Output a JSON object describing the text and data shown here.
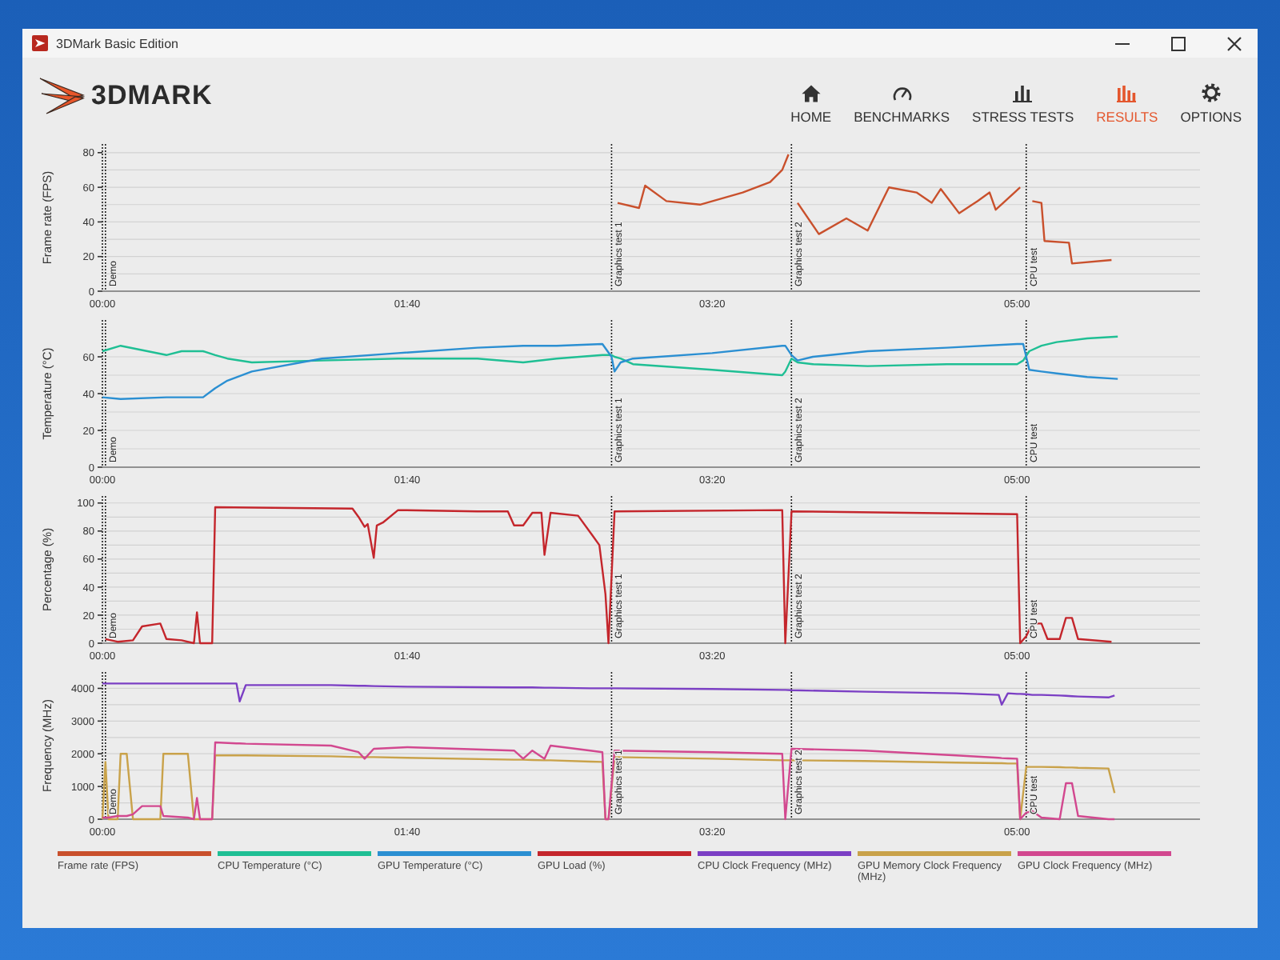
{
  "window": {
    "title": "3DMark Basic Edition"
  },
  "header": {
    "logo": "3DMARK",
    "nav": [
      {
        "label": "HOME",
        "selected": false
      },
      {
        "label": "BENCHMARKS",
        "selected": false
      },
      {
        "label": "STRESS TESTS",
        "selected": false
      },
      {
        "label": "RESULTS",
        "selected": true
      },
      {
        "label": "OPTIONS",
        "selected": false
      }
    ]
  },
  "charts": [
    {
      "chart_data": {
        "type": "line",
        "ylabel": "Frame rate (FPS)",
        "x": [
          169,
          176,
          178,
          185,
          196,
          210,
          219,
          223,
          225,
          226,
          228,
          235,
          244,
          251,
          258,
          267,
          272,
          275,
          281,
          287,
          291,
          293,
          301,
          302,
          305,
          308,
          309,
          317,
          318,
          331
        ],
        "series": [
          {
            "color": "#c9502c",
            "values": [
              51,
              48,
              61,
              52,
              50,
              57,
              63,
              70,
              79,
              null,
              51,
              33,
              42,
              35,
              60,
              57,
              51,
              59,
              45,
              52,
              57,
              47,
              60,
              null,
              52,
              51,
              29,
              28,
              16,
              18
            ]
          }
        ],
        "xlim": [
          0,
          360
        ],
        "ylim": [
          0,
          85
        ],
        "xticks": [
          {
            "value": 0,
            "label": "00:00"
          },
          {
            "value": 100,
            "label": "01:40"
          },
          {
            "value": 200,
            "label": "03:20"
          },
          {
            "value": 300,
            "label": "05:00"
          }
        ],
        "yticks": [
          0,
          20,
          40,
          60,
          80
        ],
        "grid": true,
        "ref_lines": [
          {
            "axis": "x",
            "value": 1,
            "label": "Demo"
          },
          {
            "axis": "x",
            "value": 167,
            "label": "Graphics test 1"
          },
          {
            "axis": "x",
            "value": 226,
            "label": "Graphics test 2"
          },
          {
            "axis": "x",
            "value": 303,
            "label": "CPU test"
          }
        ]
      }
    },
    {
      "chart_data": {
        "type": "line",
        "ylabel": "Temperature (°C)",
        "x": [
          0,
          6,
          21,
          26,
          33,
          37,
          41,
          49,
          72,
          97,
          123,
          138,
          149,
          164,
          167,
          168,
          170,
          174,
          200,
          223,
          224,
          226,
          228,
          233,
          251,
          277,
          300,
          302,
          304,
          308,
          313,
          323,
          333
        ],
        "series": [
          {
            "color": "#1fbf94",
            "values": [
              63,
              66,
              61,
              63,
              63,
              61,
              59,
              57,
              58,
              59,
              59,
              57,
              59,
              61,
              61,
              60,
              59,
              56,
              53,
              50,
              52,
              59,
              57,
              56,
              55,
              56,
              56,
              58,
              63,
              66,
              68,
              70,
              71
            ]
          },
          {
            "color": "#2b8fd2",
            "values": [
              38,
              37,
              38,
              38,
              38,
              43,
              47,
              52,
              59,
              62,
              65,
              66,
              66,
              67,
              60,
              52,
              57,
              59,
              62,
              66,
              66,
              61,
              58,
              60,
              63,
              65,
              67,
              67,
              53,
              52,
              51,
              49,
              48
            ]
          }
        ],
        "xlim": [
          0,
          360
        ],
        "ylim": [
          0,
          80
        ],
        "xticks": [
          {
            "value": 0,
            "label": "00:00"
          },
          {
            "value": 100,
            "label": "01:40"
          },
          {
            "value": 200,
            "label": "03:20"
          },
          {
            "value": 300,
            "label": "05:00"
          }
        ],
        "yticks": [
          0,
          20,
          40,
          60
        ],
        "grid": true,
        "ref_lines": [
          {
            "axis": "x",
            "value": 1,
            "label": "Demo"
          },
          {
            "axis": "x",
            "value": 167,
            "label": "Graphics test 1"
          },
          {
            "axis": "x",
            "value": 226,
            "label": "Graphics test 2"
          },
          {
            "axis": "x",
            "value": 303,
            "label": "CPU test"
          }
        ]
      }
    },
    {
      "chart_data": {
        "type": "line",
        "ylabel": "Percentage (%)",
        "x": [
          1,
          5,
          10,
          13,
          19,
          21,
          26,
          30,
          31,
          32,
          36,
          37,
          82,
          84,
          86,
          87,
          89,
          90,
          92,
          97,
          123,
          133,
          135,
          138,
          141,
          144,
          145,
          147,
          156,
          161,
          163,
          165,
          166,
          168,
          223,
          224,
          226,
          300,
          301,
          303,
          305,
          308,
          310,
          314,
          316,
          318,
          320,
          331
        ],
        "series": [
          {
            "color": "#c4262c",
            "values": [
              3,
              1,
              2,
              12,
              14,
              3,
              2,
              0,
              22,
              0,
              0,
              97,
              96,
              90,
              83,
              85,
              61,
              84,
              86,
              95,
              94,
              94,
              84,
              84,
              93,
              93,
              63,
              93,
              91,
              76,
              70,
              35,
              0,
              94,
              95,
              0,
              94,
              92,
              0,
              5,
              14,
              14,
              3,
              3,
              18,
              18,
              3,
              1
            ]
          }
        ],
        "xlim": [
          0,
          360
        ],
        "ylim": [
          0,
          105
        ],
        "xticks": [
          {
            "value": 0,
            "label": "00:00"
          },
          {
            "value": 100,
            "label": "01:40"
          },
          {
            "value": 200,
            "label": "03:20"
          },
          {
            "value": 300,
            "label": "05:00"
          }
        ],
        "yticks": [
          0,
          20,
          40,
          60,
          80,
          100
        ],
        "grid": true,
        "ref_lines": [
          {
            "axis": "x",
            "value": 1,
            "label": "Demo"
          },
          {
            "axis": "x",
            "value": 167,
            "label": "Graphics test 1"
          },
          {
            "axis": "x",
            "value": 226,
            "label": "Graphics test 2"
          },
          {
            "axis": "x",
            "value": 303,
            "label": "CPU test"
          }
        ]
      }
    },
    {
      "chart_data": {
        "type": "line",
        "ylabel": "Frequency (MHz)",
        "x": [
          0,
          1,
          2,
          5,
          6,
          8,
          10,
          13,
          19,
          20,
          28,
          30,
          31,
          32,
          36,
          37,
          44,
          45,
          47,
          75,
          84,
          86,
          89,
          100,
          135,
          138,
          141,
          145,
          147,
          160,
          164,
          165,
          166,
          168,
          200,
          223,
          224,
          226,
          250,
          280,
          294,
          295,
          297,
          300,
          301,
          303,
          305,
          308,
          314,
          316,
          318,
          320,
          330,
          332
        ],
        "series": [
          {
            "color": "#7b3fc4",
            "values": [
              4150,
              4150,
              4150,
              4150,
              4150,
              4150,
              4150,
              4150,
              4150,
              4150,
              4150,
              4150,
              4150,
              4150,
              4150,
              4150,
              4150,
              3600,
              4100,
              4100,
              4080,
              4080,
              4070,
              4050,
              4030,
              4030,
              4030,
              4020,
              4020,
              4000,
              4000,
              4000,
              4000,
              4000,
              3980,
              3950,
              3950,
              3940,
              3900,
              3850,
              3800,
              3500,
              3850,
              3830,
              3830,
              3820,
              3800,
              3800,
              3780,
              3770,
              3760,
              3750,
              3720,
              3780
            ]
          },
          {
            "color": "#c9a24a",
            "values": [
              0,
              1750,
              0,
              0,
              2000,
              2000,
              0,
              0,
              0,
              2000,
              2000,
              0,
              0,
              0,
              0,
              1950,
              1950,
              1950,
              1950,
              1920,
              1900,
              1900,
              1900,
              1880,
              1820,
              1820,
              1810,
              1800,
              1800,
              1760,
              1750,
              0,
              0,
              1900,
              1850,
              1800,
              1800,
              1800,
              1780,
              1730,
              1710,
              1710,
              1700,
              1700,
              0,
              1600,
              1600,
              1600,
              1590,
              1580,
              1580,
              1570,
              1550,
              800
            ]
          },
          {
            "color": "#d2488f",
            "values": [
              50,
              50,
              50,
              100,
              100,
              100,
              150,
              400,
              400,
              100,
              50,
              0,
              650,
              0,
              0,
              2350,
              2320,
              2320,
              2310,
              2250,
              2050,
              1850,
              2150,
              2200,
              2100,
              1850,
              2100,
              1850,
              2250,
              2100,
              2050,
              0,
              0,
              2100,
              2050,
              2000,
              0,
              2150,
              2100,
              1950,
              1880,
              1870,
              1860,
              1850,
              0,
              200,
              250,
              50,
              0,
              1100,
              1100,
              100,
              0,
              0
            ]
          }
        ],
        "xlim": [
          0,
          360
        ],
        "ylim": [
          0,
          4500
        ],
        "xticks": [
          {
            "value": 0,
            "label": "00:00"
          },
          {
            "value": 100,
            "label": "01:40"
          },
          {
            "value": 200,
            "label": "03:20"
          },
          {
            "value": 300,
            "label": "05:00"
          }
        ],
        "yticks": [
          0,
          1000,
          2000,
          3000,
          4000
        ],
        "grid": true,
        "ref_lines": [
          {
            "axis": "x",
            "value": 1,
            "label": "Demo"
          },
          {
            "axis": "x",
            "value": 167,
            "label": "Graphics test 1"
          },
          {
            "axis": "x",
            "value": 226,
            "label": "Graphics test 2"
          },
          {
            "axis": "x",
            "value": 303,
            "label": "CPU test"
          }
        ]
      }
    }
  ],
  "legend": [
    {
      "label": "Frame rate (FPS)",
      "color": "#c9502c"
    },
    {
      "label": "CPU Temperature (°C)",
      "color": "#1fbf94"
    },
    {
      "label": "GPU Temperature (°C)",
      "color": "#2b8fd2"
    },
    {
      "label": "GPU Load (%)",
      "color": "#c4262c"
    },
    {
      "label": "CPU Clock Frequency (MHz)",
      "color": "#7b3fc4"
    },
    {
      "label": "GPU Memory Clock Frequency (MHz)",
      "color": "#c9a24a"
    },
    {
      "label": "GPU Clock Frequency (MHz)",
      "color": "#d2488f"
    }
  ]
}
